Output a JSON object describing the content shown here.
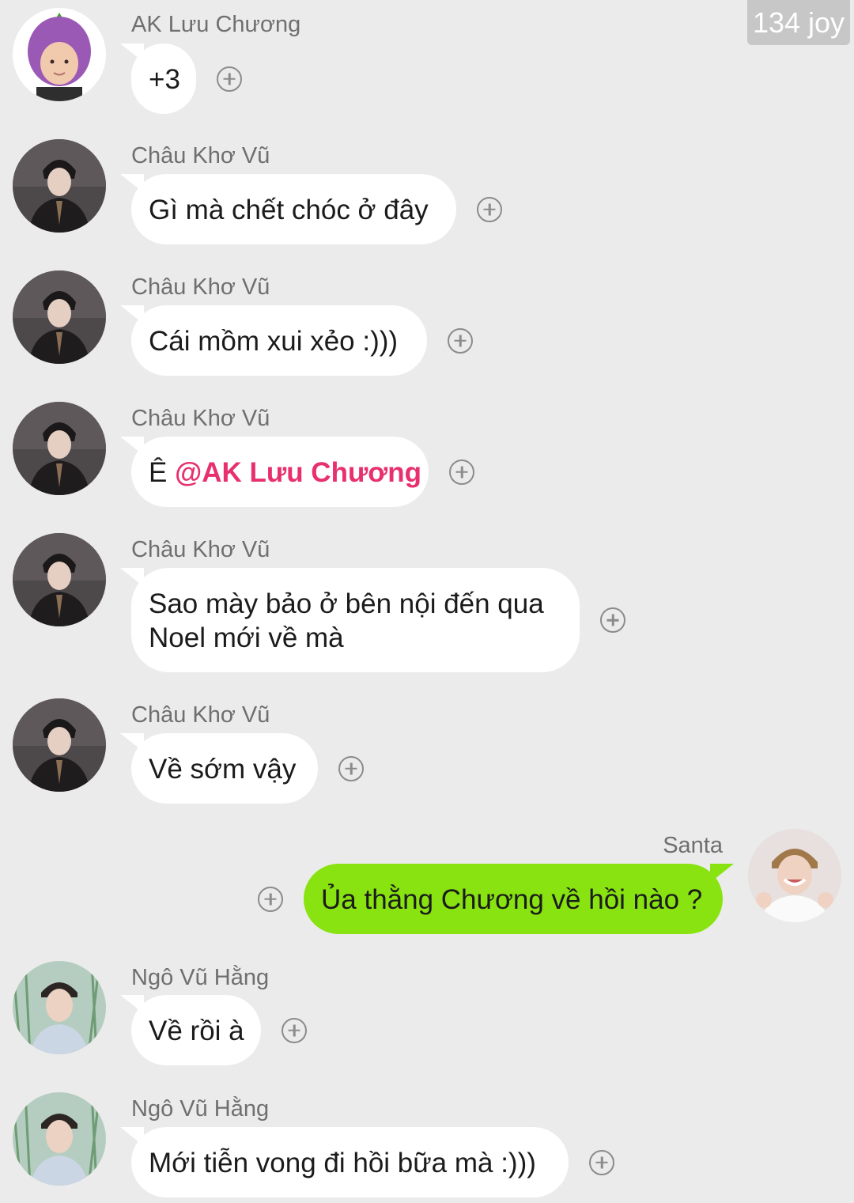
{
  "watermark": "134 joy",
  "messages": [
    {
      "side": "left",
      "sender": "AK Lưu Chương",
      "avatar": "avatar-eggplant-hat",
      "text": "+3"
    },
    {
      "side": "left",
      "sender": "Châu Khơ Vũ",
      "avatar": "avatar-dark-suit",
      "text": "Gì mà chết chóc ở đây"
    },
    {
      "side": "left",
      "sender": "Châu Khơ Vũ",
      "avatar": "avatar-dark-suit",
      "text": "Cái mồm xui xẻo :)))"
    },
    {
      "side": "left",
      "sender": "Châu Khơ Vũ",
      "avatar": "avatar-dark-suit",
      "text": "Ê ",
      "mention": "@AK Lưu Chương"
    },
    {
      "side": "left",
      "sender": "Châu Khơ Vũ",
      "avatar": "avatar-dark-suit",
      "lines": [
        "Sao mày bảo ở bên nội đến qua",
        "Noel mới về mà"
      ]
    },
    {
      "side": "left",
      "sender": "Châu Khơ Vũ",
      "avatar": "avatar-dark-suit",
      "text": "Về sớm vậy"
    },
    {
      "side": "right",
      "sender": "Santa",
      "avatar": "avatar-smiling-boy",
      "text": "Ủa thằng Chương về hồi nào ?"
    },
    {
      "side": "left",
      "sender": "Ngô Vũ Hằng",
      "avatar": "avatar-outdoor-boy",
      "text": "Về rồi à"
    },
    {
      "side": "left",
      "sender": "Ngô Vũ Hằng",
      "avatar": "avatar-outdoor-boy",
      "text": "Mới tiễn vong đi hồi bữa mà :)))"
    }
  ],
  "icons": {
    "react": "add-reaction-icon"
  },
  "colors": {
    "background": "#ebebeb",
    "bubble_left": "#ffffff",
    "bubble_right": "#88e310",
    "mention": "#e8306f",
    "sender_name": "#6f6f6f"
  }
}
